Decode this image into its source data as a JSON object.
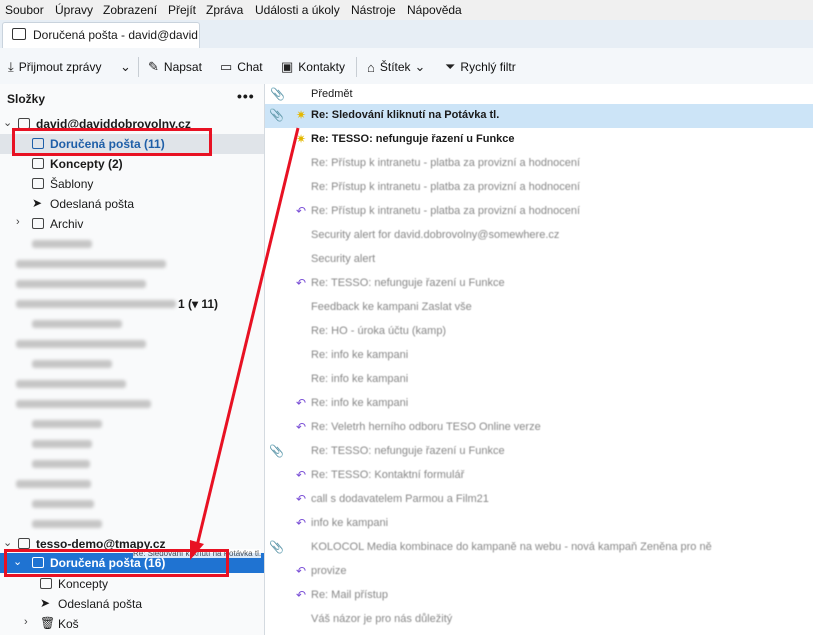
{
  "menubar": {
    "items": [
      "Soubor",
      "Úpravy",
      "Zobrazení",
      "Přejít",
      "Zpráva",
      "Události a úkoly",
      "Nástroje",
      "Nápověda"
    ]
  },
  "tab": {
    "title": "Doručená pošta - david@davidd"
  },
  "toolbar": {
    "get_messages": "Přijmout zprávy",
    "write": "Napsat",
    "chat": "Chat",
    "contacts": "Kontakty",
    "tag": "Štítek",
    "quick_filter": "Rychlý filtr"
  },
  "folders": {
    "title": "Složky",
    "account1": "david@daviddobrovolny.cz",
    "inbox1": "Doručená pošta (11)",
    "drafts1": "Koncepty (2)",
    "templates": "Šablony",
    "sent1": "Odeslaná pošta",
    "archive": "Archiv",
    "partial_count": "1 (▾ 11)",
    "account2": "tesso-demo@tmapy.cz",
    "inbox2": "Doručená pošta (16)",
    "drag_tooltip": "Re: Sledování kliknutí na Potávka tl.",
    "drafts2": "Koncepty",
    "sent2": "Odeslaná pošta",
    "trash": "Koš"
  },
  "messages": {
    "column_subject": "Předmět",
    "rows": [
      {
        "subject": "Re: Sledování kliknutí na Potávka tl.",
        "bold": true,
        "icon": "star",
        "attachment": true,
        "selected": true
      },
      {
        "subject": "Re: TESSO: nefunguje řazení u Funkce",
        "bold": true,
        "icon": "star"
      },
      {
        "subject": "Re: Přístup k intranetu - platba za provizní a hodnocení",
        "blurred": true
      },
      {
        "subject": "Re: Přístup k intranetu - platba za provizní a hodnocení",
        "blurred": true
      },
      {
        "subject": "Re: Přístup k intranetu - platba za provizní a hodnocení",
        "blurred": true,
        "icon": "reply"
      },
      {
        "subject": "Security alert for david.dobrovolny@somewhere.cz",
        "blurred": true
      },
      {
        "subject": "Security alert",
        "blurred": true
      },
      {
        "subject": "Re: TESSO: nefunguje řazení u Funkce",
        "blurred": true,
        "icon": "reply"
      },
      {
        "subject": "Feedback ke kampani Zaslat vše",
        "blurred": true
      },
      {
        "subject": "Re: HO - úroka účtu (kamp)",
        "blurred": true
      },
      {
        "subject": "Re: info ke kampani",
        "blurred": true
      },
      {
        "subject": "Re: info ke kampani",
        "blurred": true
      },
      {
        "subject": "Re: info ke kampani",
        "blurred": true,
        "icon": "reply"
      },
      {
        "subject": "Re: Veletrh herního odboru TESO Online verze",
        "blurred": true,
        "icon": "reply"
      },
      {
        "subject": "Re: TESSO: nefunguje řazení u Funkce",
        "blurred": true,
        "attachment": true
      },
      {
        "subject": "Re: TESSO: Kontaktní formulář",
        "blurred": true,
        "icon": "reply"
      },
      {
        "subject": "call s dodavatelem Parmou a Film21",
        "blurred": true,
        "icon": "reply"
      },
      {
        "subject": "info ke kampani",
        "blurred": true,
        "icon": "reply"
      },
      {
        "subject": "KOLOCOL Media kombinace do kampaně na webu - nová kampaň Zeněna pro ně",
        "blurred": true,
        "attachment": true
      },
      {
        "subject": "provize",
        "blurred": true,
        "icon": "reply"
      },
      {
        "subject": "Re: Mail přístup",
        "blurred": true,
        "icon": "reply"
      },
      {
        "subject": "Váš názor je pro nás důležitý",
        "blurred": true
      }
    ]
  },
  "colors": {
    "selection": "#cce4f7",
    "accent": "#1f73d2",
    "annotation": "#e81123"
  }
}
